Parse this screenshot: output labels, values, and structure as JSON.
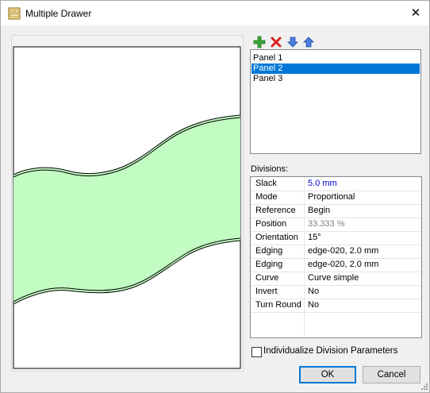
{
  "window": {
    "title": "Multiple Drawer",
    "close_glyph": "✕"
  },
  "toolbar": {
    "add_icon": "plus-icon",
    "delete_icon": "delete-x-icon",
    "move_down_icon": "arrow-down-icon",
    "move_up_icon": "arrow-up-icon"
  },
  "panels": {
    "items": [
      "Panel 1",
      "Panel 2",
      "Panel 3"
    ],
    "selected": "Panel 2"
  },
  "divisions": {
    "label": "Divisions:",
    "properties": [
      {
        "name": "Slack",
        "value": "5.0 mm"
      },
      {
        "name": "Mode",
        "value": "Proportional"
      },
      {
        "name": "Reference",
        "value": "Begin"
      },
      {
        "name": "Position",
        "value": "33.333 %"
      },
      {
        "name": "Orientation",
        "value": "15°"
      },
      {
        "name": "Edging",
        "value": "edge-020, 2.0 mm"
      },
      {
        "name": "Edging",
        "value": "edge-020, 2.0 mm"
      },
      {
        "name": "Curve",
        "value": "Curve simple"
      },
      {
        "name": "Invert",
        "value": "No"
      },
      {
        "name": "Turn Round",
        "value": "No"
      }
    ]
  },
  "options": {
    "individualize_label": "Individualize Division Parameters",
    "individualize_checked": false
  },
  "buttons": {
    "ok": "OK",
    "cancel": "Cancel"
  },
  "colors": {
    "selection": "#0078d7",
    "panel_fill": "#c2fcc2",
    "slack_value": "#0000cc",
    "position_value": "#808080",
    "add_icon": "#2e9e2e",
    "delete_icon": "#e02020",
    "arrow_icon": "#3366cc"
  }
}
